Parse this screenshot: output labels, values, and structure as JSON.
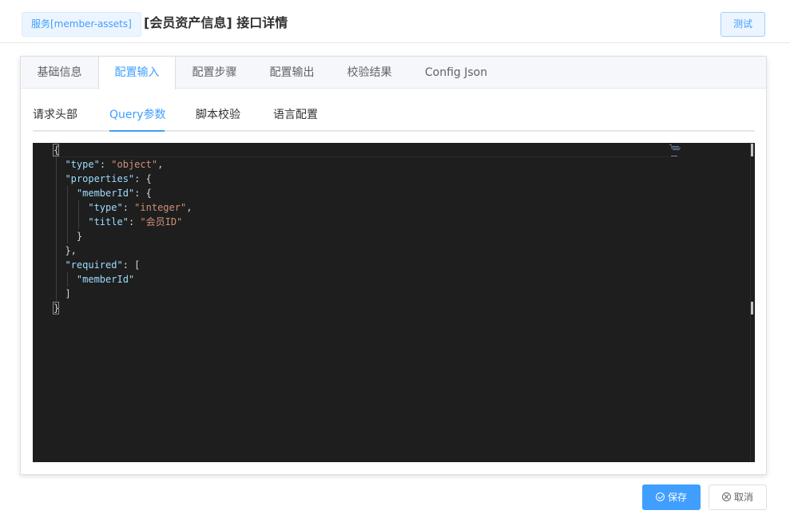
{
  "header": {
    "service_tag": "服务[member-assets]",
    "title": "[会员资产信息] 接口详情",
    "test_button": "测试"
  },
  "tabs": [
    {
      "label": "基础信息",
      "active": false
    },
    {
      "label": "配置输入",
      "active": true
    },
    {
      "label": "配置步骤",
      "active": false
    },
    {
      "label": "配置输出",
      "active": false
    },
    {
      "label": "校验结果",
      "active": false
    },
    {
      "label": "Config Json",
      "active": false
    }
  ],
  "subtabs": [
    {
      "label": "请求头部",
      "active": false
    },
    {
      "label": "Query参数",
      "active": true
    },
    {
      "label": "脚本校验",
      "active": false
    },
    {
      "label": "语言配置",
      "active": false
    }
  ],
  "editor": {
    "lines": [
      [
        [
          "p",
          "{"
        ]
      ],
      [
        [
          "p",
          "  "
        ],
        [
          "k",
          "\"type\""
        ],
        [
          "p",
          ": "
        ],
        [
          "s",
          "\"object\""
        ],
        [
          "p",
          ","
        ]
      ],
      [
        [
          "p",
          "  "
        ],
        [
          "k",
          "\"properties\""
        ],
        [
          "p",
          ": {"
        ]
      ],
      [
        [
          "p",
          "    "
        ],
        [
          "k",
          "\"memberId\""
        ],
        [
          "p",
          ": {"
        ]
      ],
      [
        [
          "p",
          "      "
        ],
        [
          "k",
          "\"type\""
        ],
        [
          "p",
          ": "
        ],
        [
          "s",
          "\"integer\""
        ],
        [
          "p",
          ","
        ]
      ],
      [
        [
          "p",
          "      "
        ],
        [
          "k",
          "\"title\""
        ],
        [
          "p",
          ": "
        ],
        [
          "s",
          "\"会员ID\""
        ]
      ],
      [
        [
          "p",
          "    }"
        ]
      ],
      [
        [
          "p",
          "  },"
        ]
      ],
      [
        [
          "p",
          "  "
        ],
        [
          "k",
          "\"required\""
        ],
        [
          "p",
          ": ["
        ]
      ],
      [
        [
          "p",
          "    "
        ],
        [
          "k",
          "\"memberId\""
        ]
      ],
      [
        [
          "p",
          "  ]"
        ]
      ],
      [
        [
          "p",
          "}"
        ]
      ]
    ],
    "colors": {
      "background": "#1e1e1e",
      "key": "#9cdcfe",
      "string": "#ce9178",
      "punctuation": "#d4d4d4"
    }
  },
  "footer": {
    "save_label": "保存",
    "cancel_label": "取消"
  },
  "colors": {
    "primary": "#409eff",
    "tag_bg": "#ecf5ff"
  }
}
